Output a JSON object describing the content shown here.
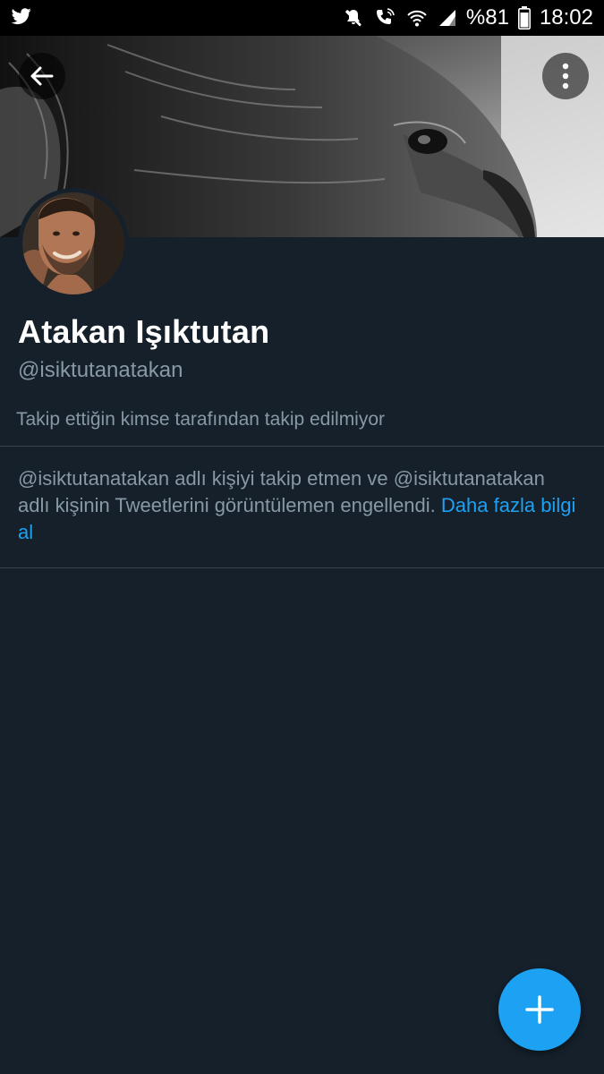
{
  "status_bar": {
    "battery_text": "%81",
    "time": "18:02",
    "icons": [
      "twitter-icon",
      "mute-icon",
      "wifi-call-icon",
      "wifi-icon",
      "signal-icon",
      "battery-icon"
    ]
  },
  "header": {
    "back_icon": "arrow-left-icon",
    "more_icon": "vertical-dots-icon"
  },
  "profile": {
    "display_name": "Atakan Işıktutan",
    "handle": "@isiktutanatakan",
    "followers_note": "Takip ettiğin kimse tarafından takip edilmiyor"
  },
  "blocked_notice": {
    "text": "@isiktutanatakan adlı kişiyi takip etmen ve @isiktutanatakan adlı kişinin Tweetlerini görüntülemen engellendi.",
    "link_text": "Daha fazla bilgi al"
  },
  "fab": {
    "icon": "plus-icon"
  },
  "colors": {
    "background": "#15202b",
    "accent": "#1da1f2",
    "secondary_text": "#8899a6",
    "divider": "#38444d"
  }
}
